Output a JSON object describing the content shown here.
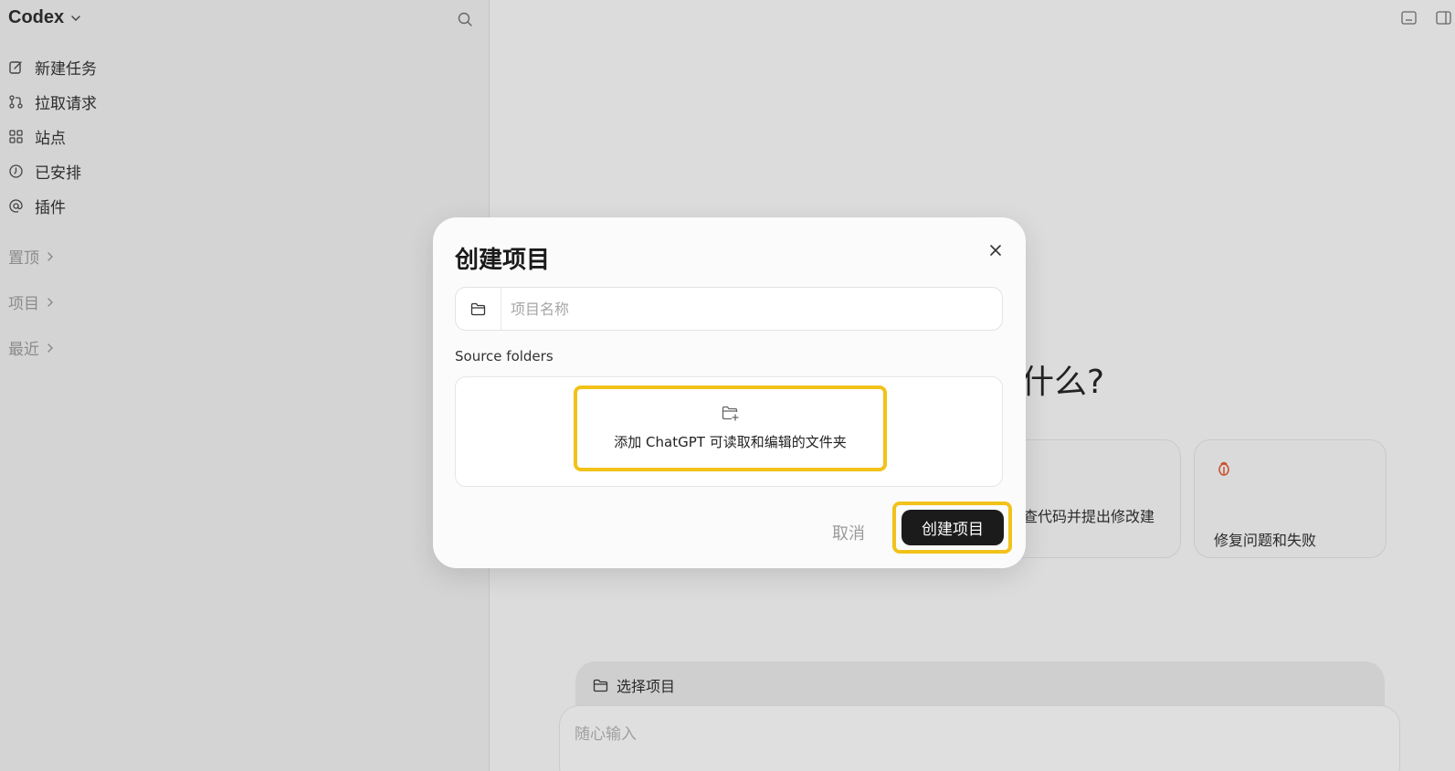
{
  "sidebar": {
    "brand": "Codex",
    "items": [
      {
        "label": "新建任务",
        "icon": "edit-icon"
      },
      {
        "label": "拉取请求",
        "icon": "pull-request-icon"
      },
      {
        "label": "站点",
        "icon": "grid-icon"
      },
      {
        "label": "已安排",
        "icon": "clock-icon"
      },
      {
        "label": "插件",
        "icon": "at-icon"
      }
    ],
    "sections": [
      "置顶",
      "项目",
      "最近"
    ]
  },
  "main": {
    "headline": "什么?",
    "cards": [
      {
        "label": "查代码并提出修改建",
        "icon": ""
      },
      {
        "label": "修复问题和失败",
        "icon": "bug-icon"
      }
    ],
    "project_selector": "选择项目",
    "composer_placeholder": "随心输入"
  },
  "modal": {
    "title": "创建项目",
    "name_placeholder": "项目名称",
    "source_label": "Source folders",
    "add_folder_label": "添加 ChatGPT 可读取和编辑的文件夹",
    "cancel_label": "取消",
    "create_label": "创建项目"
  },
  "colors": {
    "highlight": "#f2c21a",
    "primary_button": "#1b1b1b",
    "bug_icon": "#c8502a"
  }
}
